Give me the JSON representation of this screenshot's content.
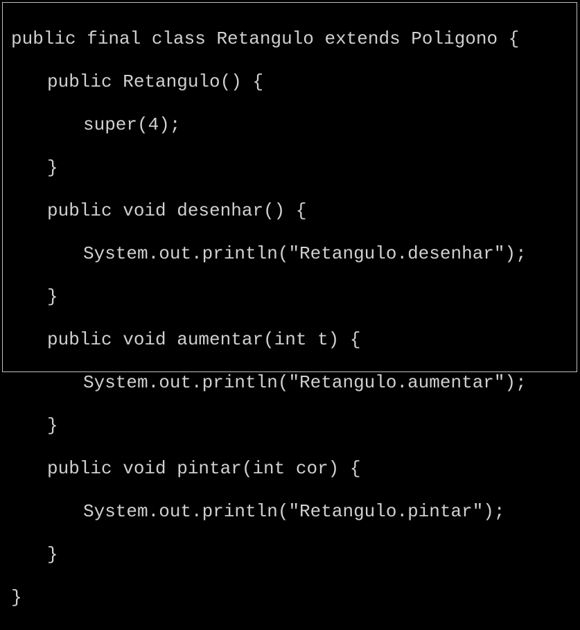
{
  "code": {
    "l1": "public final class Retangulo extends Poligono {",
    "l2": "public Retangulo() {",
    "l3": "super(4);",
    "l4": "}",
    "l5": "public void desenhar() {",
    "l6": "System.out.println(\"Retangulo.desenhar\");",
    "l7": "}",
    "l8": "public void aumentar(int t) {",
    "l9": "System.out.println(\"Retangulo.aumentar\");",
    "l10": "}",
    "l11": "public void pintar(int cor) {",
    "l12": "System.out.println(\"Retangulo.pintar\");",
    "l13": "}",
    "l14": "}"
  }
}
